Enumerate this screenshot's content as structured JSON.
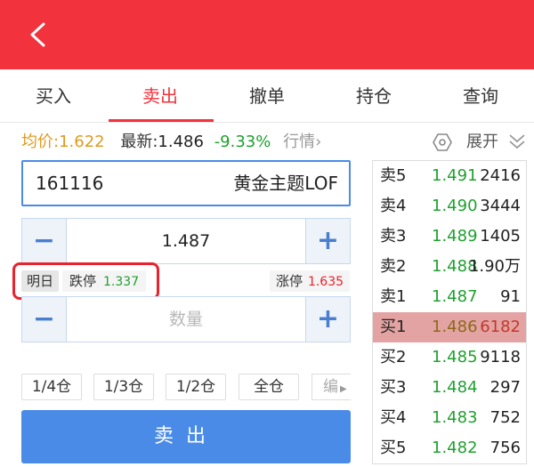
{
  "header": {
    "back_icon": "chevron-left-icon",
    "bg_color": "#f2323c"
  },
  "tabs": [
    {
      "label": "买入"
    },
    {
      "label": "卖出",
      "active": true
    },
    {
      "label": "撤单"
    },
    {
      "label": "持仓"
    },
    {
      "label": "查询"
    }
  ],
  "quote": {
    "avg_label": "均价:",
    "avg_value": "1.622",
    "last_label": "最新:",
    "last_value": "1.486",
    "change_pct": "-9.33%",
    "market_link": "行情",
    "expand_label": "展开"
  },
  "stock": {
    "code": "161116",
    "name": "黄金主题LOF"
  },
  "price_stepper": {
    "minus": "−",
    "value": "1.487",
    "plus": "+"
  },
  "limits": {
    "tomorrow_tag": "明日",
    "limit_down_label": "跌停",
    "limit_down_value": "1.337",
    "limit_up_label": "涨停",
    "limit_up_value": "1.635"
  },
  "qty_stepper": {
    "minus": "−",
    "placeholder": "数量",
    "plus": "+"
  },
  "positions": [
    "1/4仓",
    "1/3仓",
    "1/2仓",
    "全仓"
  ],
  "positions_more": "编",
  "submit_label": "卖出",
  "order_book": [
    {
      "label": "卖5",
      "price": "1.491",
      "volume": "2416"
    },
    {
      "label": "卖4",
      "price": "1.490",
      "volume": "3444"
    },
    {
      "label": "卖3",
      "price": "1.489",
      "volume": "1405"
    },
    {
      "label": "卖2",
      "price": "1.488",
      "volume": "1.90万"
    },
    {
      "label": "卖1",
      "price": "1.487",
      "volume": "91"
    },
    {
      "label": "买1",
      "price": "1.486",
      "volume": "6182",
      "highlight": true
    },
    {
      "label": "买2",
      "price": "1.485",
      "volume": "9118"
    },
    {
      "label": "买3",
      "price": "1.484",
      "volume": "297"
    },
    {
      "label": "买4",
      "price": "1.483",
      "volume": "752"
    },
    {
      "label": "买5",
      "price": "1.482",
      "volume": "756"
    }
  ]
}
